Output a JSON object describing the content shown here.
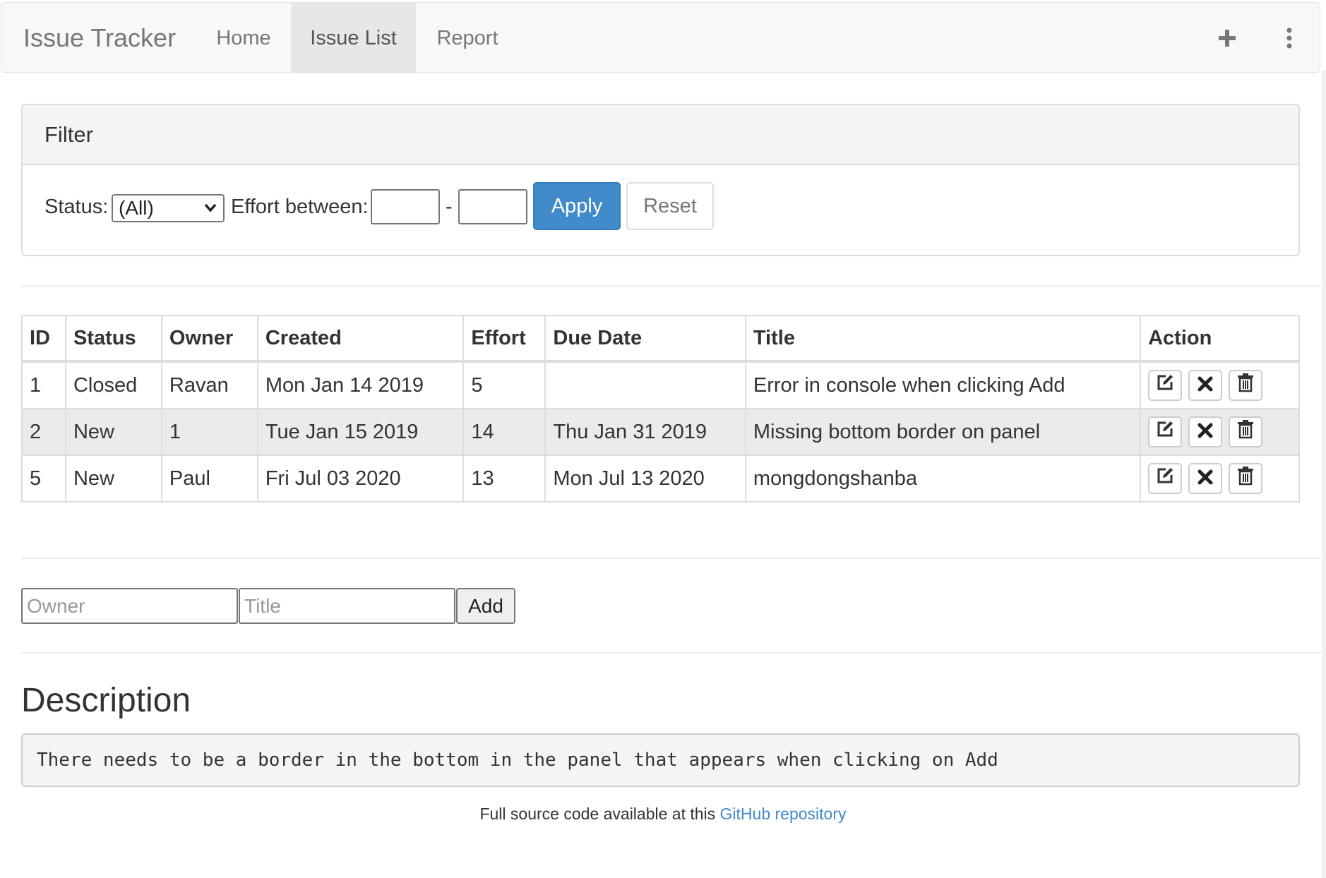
{
  "navbar": {
    "brand": "Issue Tracker",
    "tabs": [
      {
        "label": "Home"
      },
      {
        "label": "Issue List",
        "active": true
      },
      {
        "label": "Report"
      }
    ],
    "icons": [
      "plus-icon",
      "kebab-menu-icon"
    ]
  },
  "filter": {
    "heading": "Filter",
    "status_label": "Status:",
    "status_selected": "(All)",
    "effort_label": "Effort between:",
    "range_separator": "-",
    "effort_min": "",
    "effort_max": "",
    "apply_label": "Apply",
    "reset_label": "Reset"
  },
  "table": {
    "columns": [
      "ID",
      "Status",
      "Owner",
      "Created",
      "Effort",
      "Due Date",
      "Title",
      "Action"
    ],
    "rows": [
      {
        "id": "1",
        "status": "Closed",
        "owner": "Ravan",
        "created": "Mon Jan 14 2019",
        "effort": "5",
        "due": "",
        "title": "Error in console when clicking Add"
      },
      {
        "id": "2",
        "status": "New",
        "owner": "1",
        "created": "Tue Jan 15 2019",
        "effort": "14",
        "due": "Thu Jan 31 2019",
        "title": "Missing bottom border on panel"
      },
      {
        "id": "5",
        "status": "New",
        "owner": "Paul",
        "created": "Fri Jul 03 2020",
        "effort": "13",
        "due": "Mon Jul 13 2020",
        "title": "mongdongshanba"
      }
    ],
    "action_icons": [
      "edit-icon",
      "close-icon",
      "trash-icon"
    ]
  },
  "add_form": {
    "owner_placeholder": "Owner",
    "title_placeholder": "Title",
    "add_label": "Add"
  },
  "description": {
    "heading": "Description",
    "text": "There needs to be a border in the bottom in the panel that appears when clicking on Add"
  },
  "footer": {
    "prefix": "Full source code available at this ",
    "link_text": "GitHub repository"
  },
  "colors": {
    "primary": "#428bca",
    "navbar_bg": "#f8f8f8",
    "active_tab_bg": "#e7e7e7",
    "striped_row_bg": "#ebebeb"
  }
}
